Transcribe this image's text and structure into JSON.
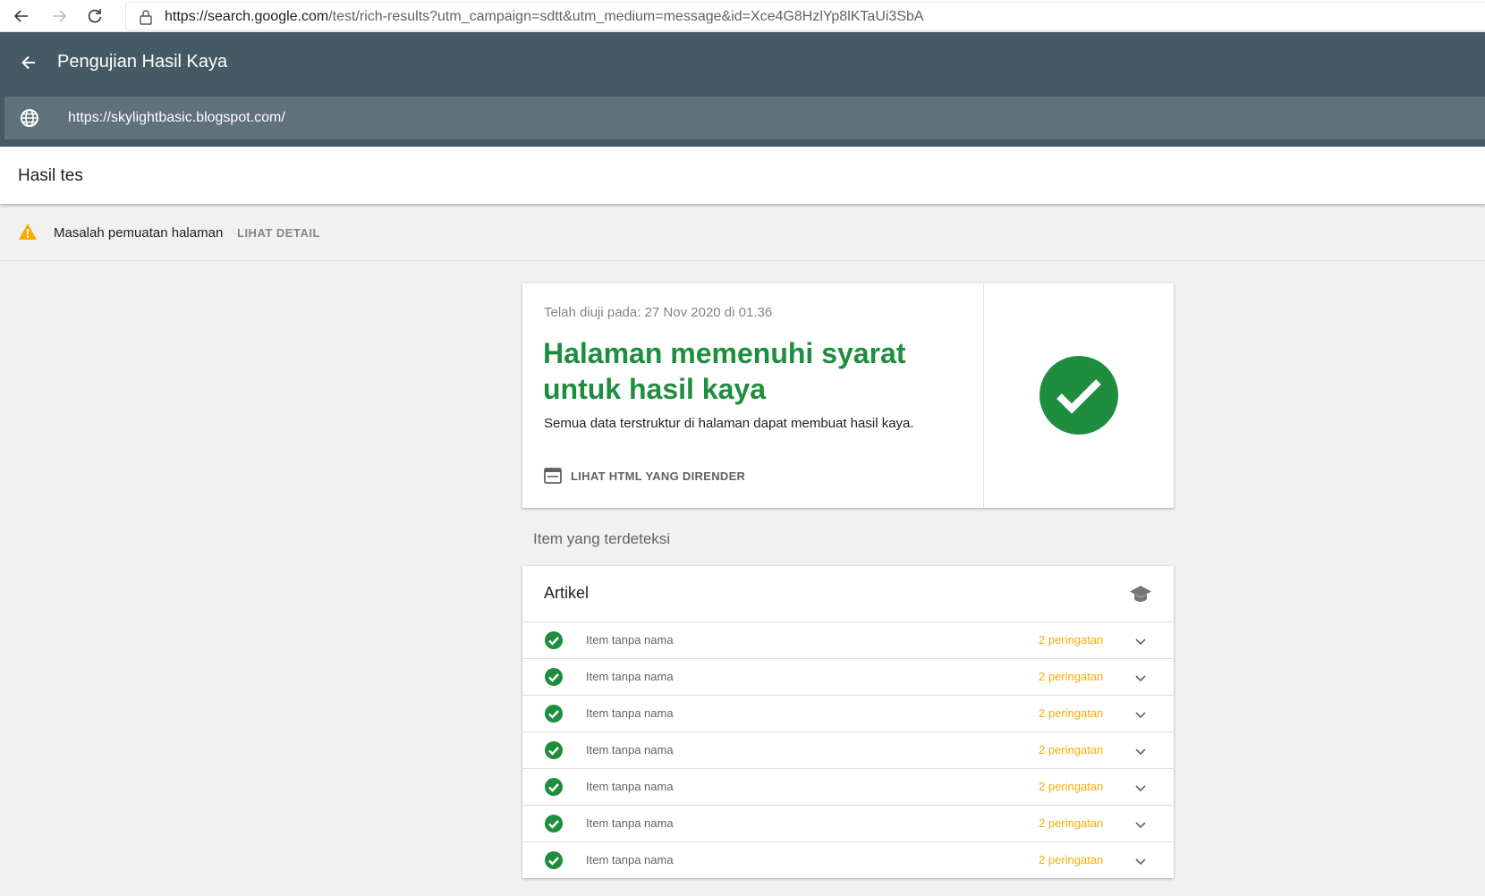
{
  "browser": {
    "url_host": "https://search.google.com",
    "url_path": "/test/rich-results?utm_campaign=sdtt&utm_medium=message&id=Xce4G8HzlYp8lKTaUi3SbA"
  },
  "header": {
    "title": "Pengujian Hasil Kaya",
    "tested_url": "https://skylightbasic.blogspot.com/"
  },
  "results": {
    "title": "Hasil tes"
  },
  "warning": {
    "text": "Masalah pemuatan halaman",
    "link": "LIHAT DETAIL"
  },
  "summary": {
    "tested_on": "Telah diuji pada: 27 Nov 2020 di 01.36",
    "headline": "Halaman memenuhi syarat untuk hasil kaya",
    "subtext": "Semua data terstruktur di halaman dapat membuat hasil kaya.",
    "view_html": "LIHAT HTML YANG DIRENDER"
  },
  "detected": {
    "title": "Item yang terdeteksi",
    "group_title": "Artikel",
    "items": [
      {
        "name": "Item tanpa nama",
        "warnings": "2 peringatan"
      },
      {
        "name": "Item tanpa nama",
        "warnings": "2 peringatan"
      },
      {
        "name": "Item tanpa nama",
        "warnings": "2 peringatan"
      },
      {
        "name": "Item tanpa nama",
        "warnings": "2 peringatan"
      },
      {
        "name": "Item tanpa nama",
        "warnings": "2 peringatan"
      },
      {
        "name": "Item tanpa nama",
        "warnings": "2 peringatan"
      },
      {
        "name": "Item tanpa nama",
        "warnings": "2 peringatan"
      }
    ]
  },
  "colors": {
    "header_bg": "#455a64",
    "success": "#1e8e3e",
    "warning": "#f9ab00"
  }
}
